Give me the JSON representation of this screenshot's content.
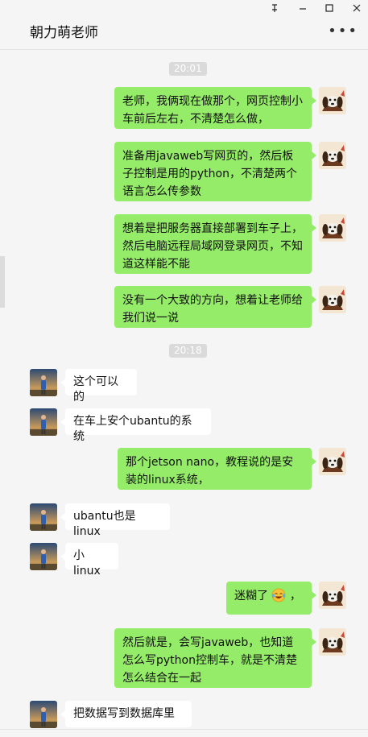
{
  "window": {
    "title": "朝力萌老师",
    "pin_icon": "pin-icon",
    "minimize_icon": "minimize-icon",
    "maximize_icon": "maximize-icon",
    "close_icon": "close-icon",
    "more_icon": "more-options-icon"
  },
  "chat": {
    "times": [
      "20:01",
      "20:18"
    ],
    "messages": [
      {
        "sender": "me",
        "text": "老师，我俩现在做那个，网页控制小车前后左右，不清楚怎么做，"
      },
      {
        "sender": "me",
        "text": "准备用javaweb写网页的，然后板子控制是用的python，不清楚两个语言怎么传参数"
      },
      {
        "sender": "me",
        "text": "想着是把服务器直接部署到车子上，然后电脑远程局域网登录网页，不知道这样能不能"
      },
      {
        "sender": "me",
        "text": "没有一个大致的方向，想着让老师给我们说一说"
      },
      {
        "sender": "them",
        "text": "这个可以的"
      },
      {
        "sender": "them",
        "text": "在车上安个ubantu的系统"
      },
      {
        "sender": "me",
        "text": "那个jetson nano，教程说的是安装的linux系统，"
      },
      {
        "sender": "them",
        "text": "ubantu也是linux"
      },
      {
        "sender": "them",
        "text": "小linux"
      },
      {
        "sender": "me",
        "text_before_emoji": "迷糊了",
        "emoji": "tears-of-joy-emoji",
        "text_after_emoji": "，"
      },
      {
        "sender": "me",
        "text": "然后就是，会写javaweb，也知道怎么写python控制车，就是不清楚怎么结合在一起"
      },
      {
        "sender": "them",
        "text": "把数据写到数据库里"
      }
    ]
  },
  "colors": {
    "background": "#f5f5f5",
    "my_bubble": "#95ec69",
    "their_bubble": "#ffffff",
    "time_badge": "#dadada"
  }
}
